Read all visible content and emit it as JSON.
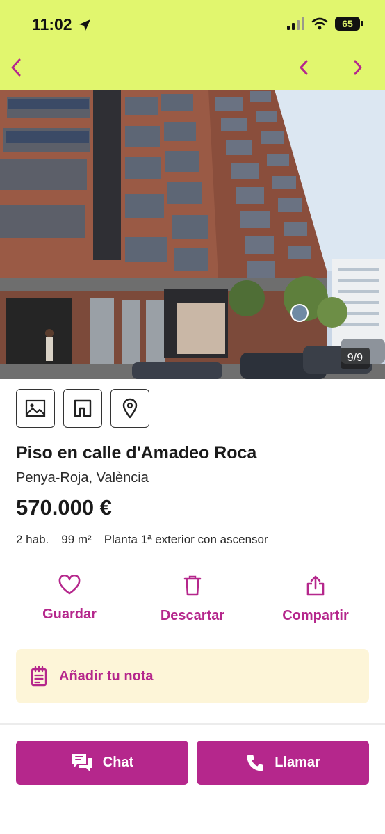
{
  "status_bar": {
    "time": "11:02",
    "battery": "65",
    "icons": [
      "location-arrow-icon",
      "signal-icon",
      "wifi-icon",
      "battery-icon"
    ]
  },
  "header": {
    "icons": [
      "chevron-left-icon",
      "chevron-left-icon",
      "chevron-right-icon"
    ],
    "background_color": "#e1f66e",
    "icon_color": "#b5278c"
  },
  "gallery": {
    "counter": "9/9"
  },
  "view_tabs": {
    "icons": [
      "image-icon",
      "floor-plan-icon",
      "map-pin-icon"
    ]
  },
  "listing": {
    "title": "Piso en calle d'Amadeo Roca",
    "location": "Penya-Roja, València",
    "price": "570.000 €",
    "features": [
      "2 hab.",
      "99 m²",
      "Planta 1ª exterior con ascensor"
    ]
  },
  "actions": {
    "save_label": "Guardar",
    "discard_label": "Descartar",
    "share_label": "Compartir",
    "icons": [
      "heart-icon",
      "trash-icon",
      "share-icon"
    ]
  },
  "note": {
    "label": "Añadir tu nota",
    "icon": "notepad-icon",
    "background_color": "#fdf5d8"
  },
  "contact": {
    "chat_label": "Chat",
    "call_label": "Llamar",
    "icons": [
      "chat-icon",
      "phone-icon"
    ],
    "button_color": "#b5278c"
  }
}
